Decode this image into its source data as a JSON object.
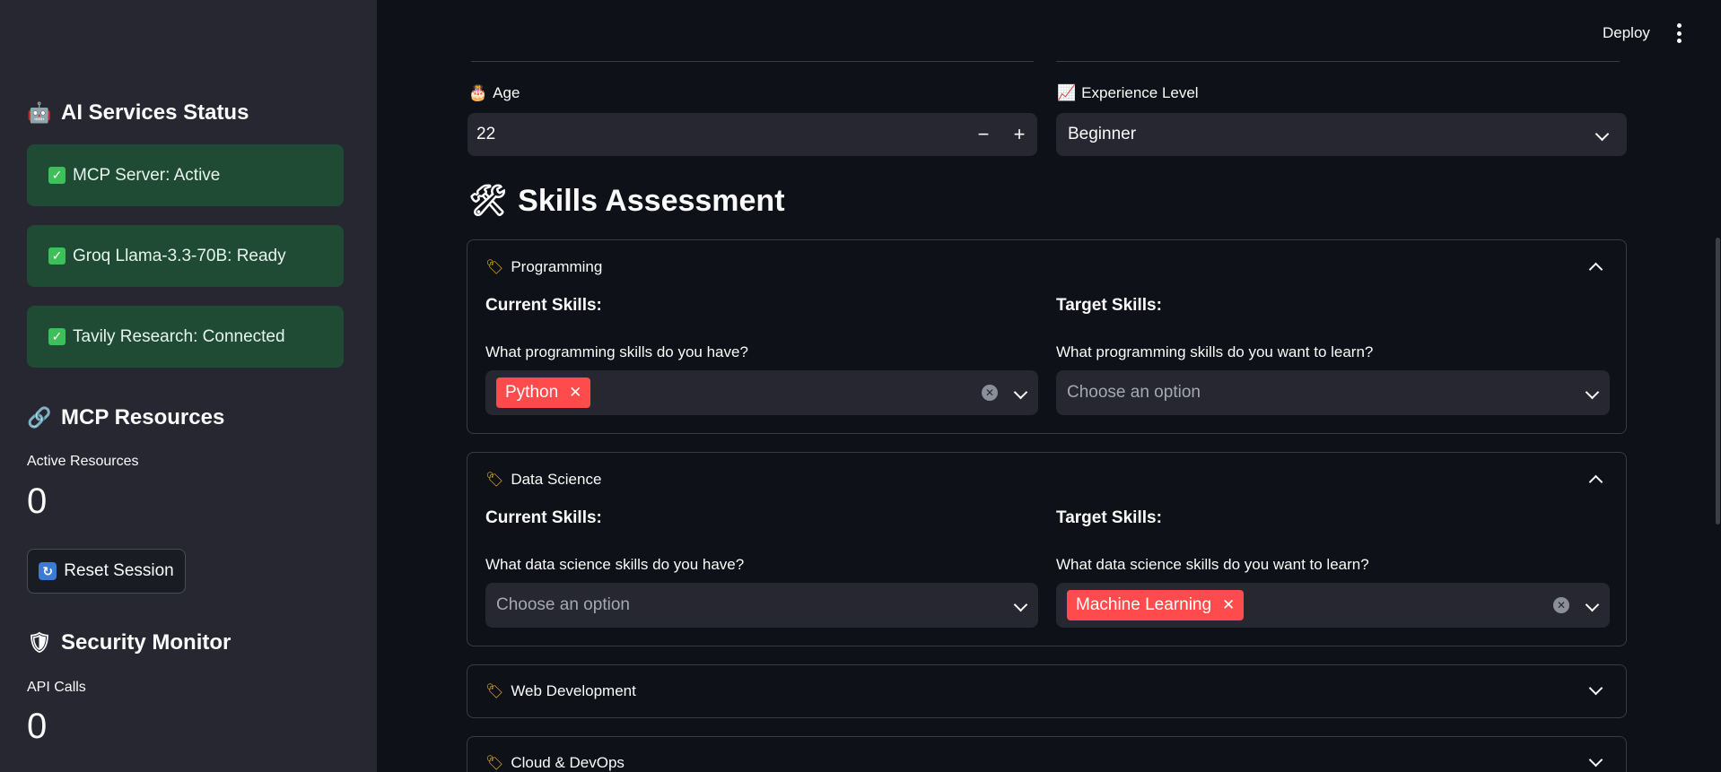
{
  "sidebar": {
    "ai_status": {
      "icon": "robot-icon",
      "title": "AI Services Status",
      "items": [
        {
          "label": "MCP Server: Active"
        },
        {
          "label": "Groq Llama-3.3-70B: Ready"
        },
        {
          "label": "Tavily Research: Connected"
        }
      ]
    },
    "mcp_resources": {
      "icon": "link-icon",
      "title": "MCP Resources",
      "metric_label": "Active Resources",
      "metric_value": "0"
    },
    "reset_button": {
      "label": "Reset Session",
      "icon": "refresh-icon"
    },
    "security": {
      "icon": "shield-icon",
      "title": "Security Monitor",
      "metric_label": "API Calls",
      "metric_value": "0"
    }
  },
  "topbar": {
    "deploy_label": "Deploy",
    "menu_icon": "kebab-menu-icon"
  },
  "form": {
    "age": {
      "label": "Age",
      "icon": "cake-icon",
      "value": "22",
      "minus": "−",
      "plus": "+"
    },
    "experience": {
      "label": "Experience Level",
      "icon": "chart-icon",
      "value": "Beginner"
    }
  },
  "skills": {
    "title": "Skills Assessment",
    "icon": "tools-icon",
    "current_heading": "Current Skills:",
    "target_heading": "Target Skills:",
    "sections": [
      {
        "name": "Programming",
        "expanded": true,
        "current_question": "What programming skills do you have?",
        "current_selected": [
          "Python"
        ],
        "current_placeholder": "",
        "target_question": "What programming skills do you want to learn?",
        "target_selected": [],
        "target_placeholder": "Choose an option"
      },
      {
        "name": "Data Science",
        "expanded": true,
        "current_question": "What data science skills do you have?",
        "current_selected": [],
        "current_placeholder": "Choose an option",
        "target_question": "What data science skills do you want to learn?",
        "target_selected": [
          "Machine Learning"
        ],
        "target_placeholder": ""
      },
      {
        "name": "Web Development",
        "expanded": false
      },
      {
        "name": "Cloud & DevOps",
        "expanded": false
      }
    ]
  },
  "colors": {
    "accent": "#ff4b4b",
    "success_bg": "#1f4a33",
    "sidebar_bg": "#262730",
    "main_bg": "#0e1117"
  }
}
